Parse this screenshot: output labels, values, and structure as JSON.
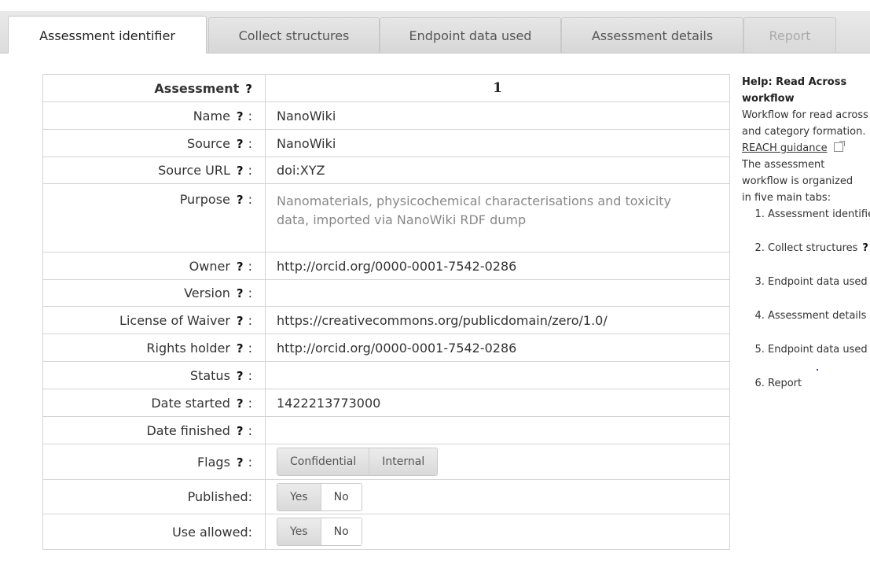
{
  "tabs": [
    {
      "label": "Assessment identifier",
      "state": "active"
    },
    {
      "label": "Collect structures",
      "state": "normal"
    },
    {
      "label": "Endpoint data used",
      "state": "normal"
    },
    {
      "label": "Assessment details",
      "state": "normal"
    },
    {
      "label": "Report",
      "state": "disabled"
    }
  ],
  "form": {
    "header": {
      "label": "Assessment",
      "value": "1"
    },
    "fields": {
      "name": {
        "label": "Name",
        "value": "NanoWiki"
      },
      "source": {
        "label": "Source",
        "value": "NanoWiki"
      },
      "source_url": {
        "label": "Source URL",
        "value": "doi:XYZ"
      },
      "purpose": {
        "label": "Purpose",
        "value": "Nanomaterials, physicochemical characterisations and toxicity data, imported via NanoWiki RDF dump"
      },
      "owner": {
        "label": "Owner",
        "value": "http://orcid.org/0000-0001-7542-0286"
      },
      "version": {
        "label": "Version",
        "value": ""
      },
      "license": {
        "label": "License of Waiver",
        "value": "https://creativecommons.org/publicdomain/zero/1.0/"
      },
      "rights_holder": {
        "label": "Rights holder",
        "value": "http://orcid.org/0000-0001-7542-0286"
      },
      "status": {
        "label": "Status",
        "value": ""
      },
      "date_started": {
        "label": "Date started",
        "value": "1422213773000"
      },
      "date_finished": {
        "label": "Date finished",
        "value": ""
      },
      "flags": {
        "label": "Flags",
        "options": [
          "Confidential",
          "Internal"
        ]
      },
      "published": {
        "label": "Published:",
        "options": [
          "Yes",
          "No"
        ],
        "selected": "Yes"
      },
      "use_allowed": {
        "label": "Use allowed:",
        "options": [
          "Yes",
          "No"
        ],
        "selected": "Yes"
      }
    },
    "help_marker": "?",
    "colon": ":"
  },
  "help": {
    "title": "Help: Read Across workflow",
    "text1": "Workflow for read across and category formation.",
    "link": "REACH guidance",
    "text2": "The assessment workflow is organized in five main tabs:",
    "steps": [
      "Assessment identifier",
      "Collect structures",
      "Endpoint data used",
      "Assessment details",
      "Endpoint data used",
      "Report"
    ]
  }
}
